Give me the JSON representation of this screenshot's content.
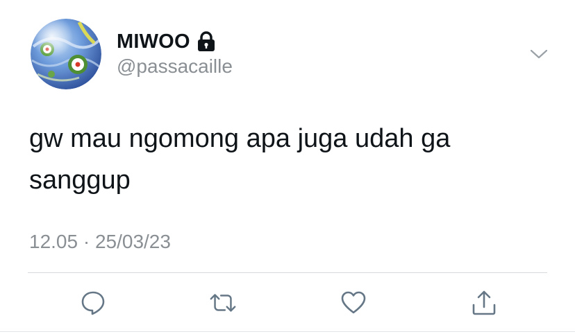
{
  "user": {
    "display_name": "MIWOO",
    "handle": "@passacaille",
    "protected_icon": "lock-icon",
    "avatar_icon": "marble-avatar"
  },
  "tweet": {
    "text": "gw mau ngomong apa juga udah ga sanggup",
    "timestamp": "12.05 · 25/03/23"
  },
  "menu": {
    "icon": "chevron-down-icon"
  },
  "actions": [
    {
      "name": "reply",
      "icon": "reply-icon"
    },
    {
      "name": "retweet",
      "icon": "retweet-icon"
    },
    {
      "name": "like",
      "icon": "heart-icon"
    },
    {
      "name": "share",
      "icon": "share-icon"
    }
  ],
  "colors": {
    "text": "#0f1419",
    "secondary": "#8a8f94",
    "icon": "#657786",
    "divider": "#d6dadd"
  }
}
